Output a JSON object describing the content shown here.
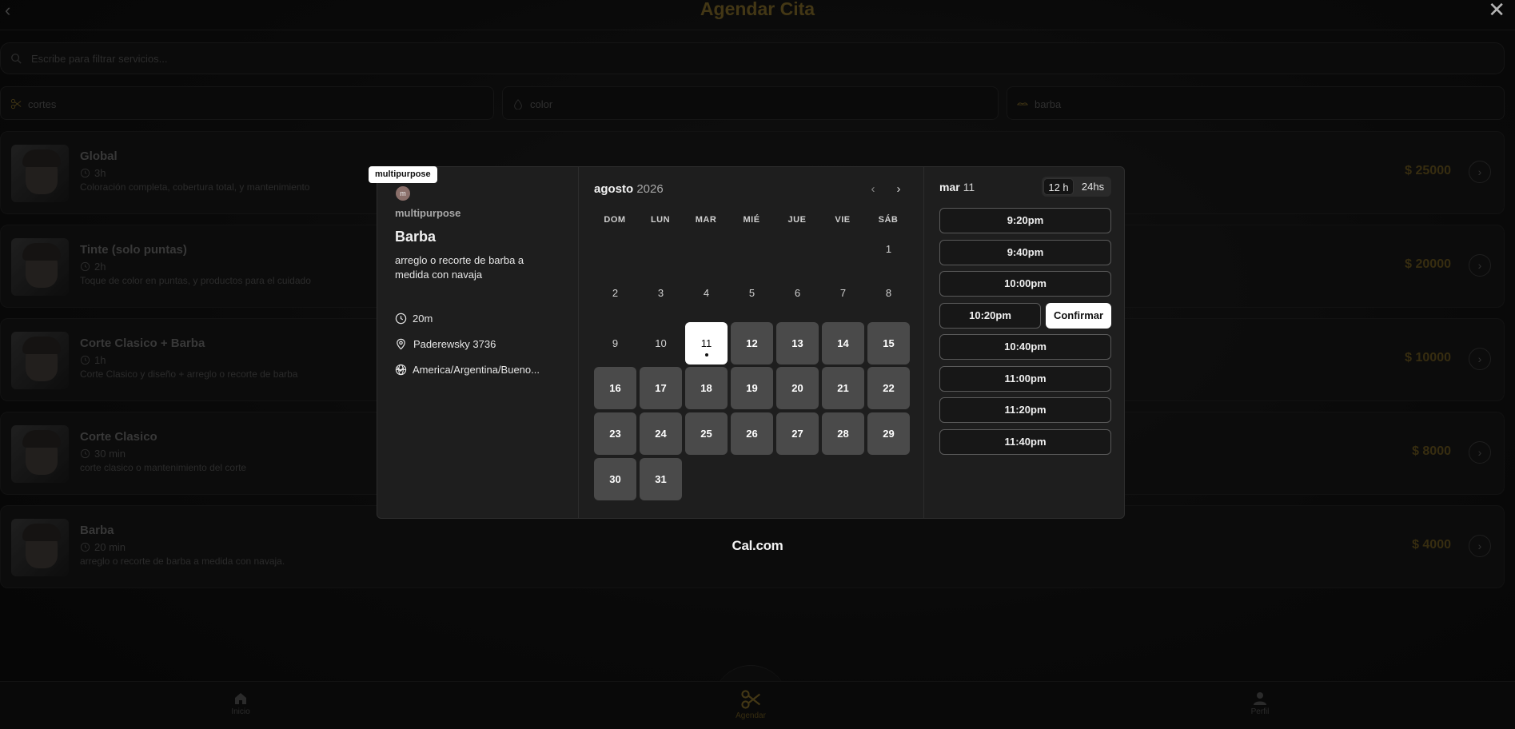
{
  "app": {
    "title": "Agendar Cita",
    "search_placeholder": "Escribe para filtrar servicios...",
    "categories": [
      {
        "label": "cortes",
        "icon": "scissors-icon"
      },
      {
        "label": "color",
        "icon": "drop-icon"
      },
      {
        "label": "barba",
        "icon": "mustache-icon"
      }
    ],
    "services": [
      {
        "name": "Global",
        "duration": "3h",
        "description": "Coloración completa, cobertura total, y mantenimiento",
        "price": "$ 25000"
      },
      {
        "name": "Tinte (solo puntas)",
        "duration": "2h",
        "description": "Toque de color en puntas, y productos para el cuidado",
        "price": "$ 20000"
      },
      {
        "name": "Corte Clasico + Barba",
        "duration": "1h",
        "description": "Corte Clasico y diseño + arreglo o recorte de barba",
        "price": "$ 10000"
      },
      {
        "name": "Corte Clasico",
        "duration": "30 min",
        "description": "corte clasico o mantenimiento del corte",
        "price": "$ 8000"
      },
      {
        "name": "Barba",
        "duration": "20 min",
        "description": "arreglo o recorte de barba a medida con navaja.",
        "price": "$ 4000"
      }
    ],
    "nav": [
      {
        "label": "Inicio",
        "icon": "home-icon"
      },
      {
        "label": "Agendar",
        "icon": "scissors-icon"
      },
      {
        "label": "Perfil",
        "icon": "user-icon"
      }
    ]
  },
  "booking": {
    "tooltip": "multipurpose",
    "avatar_letter": "m",
    "org_name": "multipurpose",
    "event_title": "Barba",
    "event_description": "arreglo o recorte de barba a medida con navaja",
    "duration": "20m",
    "location": "Paderewsky 3736",
    "timezone": "America/Argentina/Bueno...",
    "month": "agosto",
    "year": "2026",
    "weekdays": [
      "DOM",
      "LUN",
      "MAR",
      "MIÉ",
      "JUE",
      "VIE",
      "SÁB"
    ],
    "start_weekday_index": 6,
    "days_in_month": 31,
    "selected_day": 11,
    "available_days": [
      11,
      12,
      13,
      14,
      15,
      16,
      17,
      18,
      19,
      20,
      21,
      22,
      23,
      24,
      25,
      26,
      27,
      28,
      29,
      30,
      31
    ],
    "slot_weekday": "mar",
    "slot_daynum": "11",
    "format_12h": "12 h",
    "format_24h": "24hs",
    "slots": [
      "9:20pm",
      "9:40pm",
      "10:00pm",
      "10:20pm",
      "10:40pm",
      "11:00pm",
      "11:20pm",
      "11:40pm"
    ],
    "selected_slot": "10:20pm",
    "confirm_label": "Confirmar",
    "brand": "Cal.com"
  }
}
